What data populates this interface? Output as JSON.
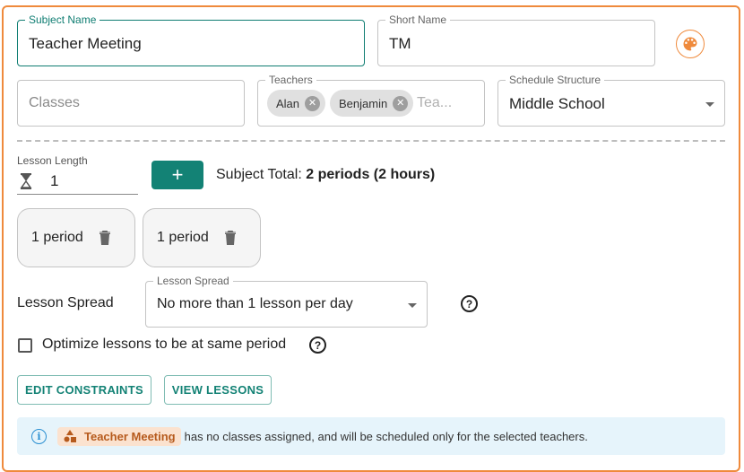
{
  "subject_name": {
    "label": "Subject Name",
    "value": "Teacher Meeting"
  },
  "short_name": {
    "label": "Short Name",
    "value": "TM"
  },
  "classes": {
    "placeholder": "Classes"
  },
  "teachers": {
    "label": "Teachers",
    "chips": [
      "Alan",
      "Benjamin"
    ],
    "placeholder": "Tea..."
  },
  "schedule_structure": {
    "label": "Schedule Structure",
    "value": "Middle School"
  },
  "lesson_length": {
    "label": "Lesson Length",
    "value": "1"
  },
  "add_button": {
    "label": "+"
  },
  "subject_total": {
    "prefix": "Subject Total: ",
    "value": "2 periods (2 hours)"
  },
  "lessons": [
    "1 period",
    "1 period"
  ],
  "lesson_spread": {
    "row_label": "Lesson Spread",
    "field_label": "Lesson Spread",
    "value": "No more than 1 lesson per day"
  },
  "optimize": {
    "label": "Optimize lessons to be at same period",
    "checked": false
  },
  "buttons": {
    "edit_constraints": "EDIT CONSTRAINTS",
    "view_lessons": "VIEW LESSONS"
  },
  "alert": {
    "subject": "Teacher Meeting",
    "message": "has no classes assigned, and will be scheduled only for the selected teachers."
  },
  "help_glyph": "?",
  "info_glyph": "i",
  "colors": {
    "accent": "#138275",
    "frame": "#ef8a3c",
    "alert_bg": "#e6f4fb"
  }
}
